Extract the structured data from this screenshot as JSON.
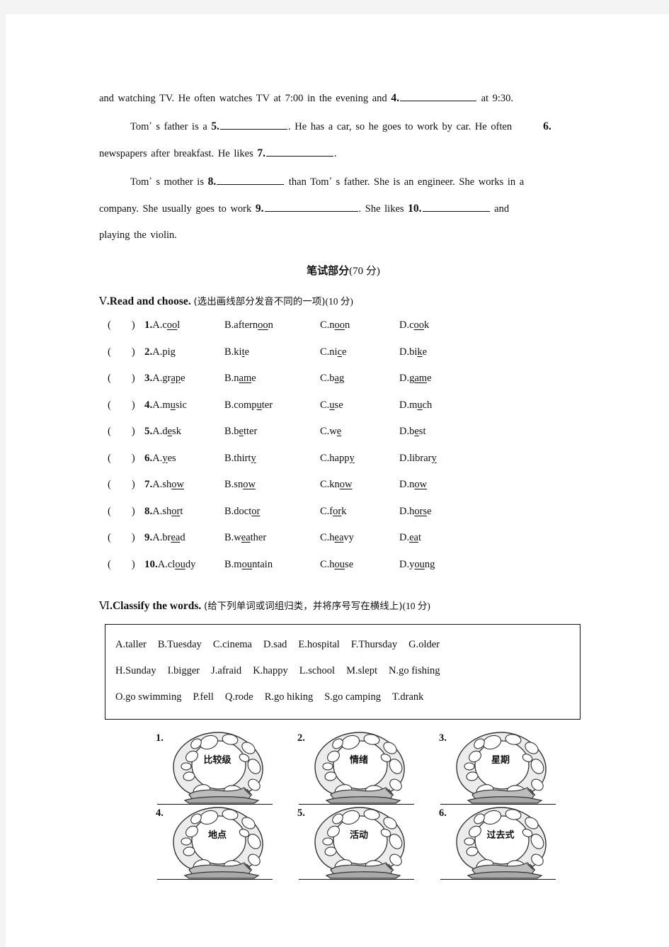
{
  "cloze": {
    "line1_before": "and watching TV. He often watches TV at 7:00 in the evening and",
    "n4": "4.",
    "line1_after": "at 9:30.",
    "p2_a": "Tom",
    "p2_b": "s father is a",
    "n5": "5.",
    "p2_c": ". He has a car, so he goes to work by car. He often",
    "n6": "6.",
    "p2_d": "newspapers after breakfast. He likes",
    "n7": "7.",
    "p2_e": ".",
    "p3_a": "Tom",
    "p3_b": "s mother is",
    "n8": "8.",
    "p3_c": "than Tom",
    "p3_d": "s father. She is an engineer. She works in a",
    "p3_e": "company. She usually goes to work",
    "n9": "9.",
    "p3_f": ". She likes",
    "n10": "10.",
    "p3_g": "and",
    "p3_h": "playing the violin.",
    "apostrophe": "’"
  },
  "part_title": {
    "cn": "笔试部分",
    "points": "(70 分)"
  },
  "section5": {
    "numeral": "Ⅴ",
    "title": ".Read and choose.",
    "cn": "(选出画线部分发音不同的一项)",
    "points": "(10 分)",
    "paren": "(        )",
    "questions": [
      {
        "num": "1.",
        "options": [
          {
            "letter": "A.",
            "pre": "c",
            "mid": "oo",
            "post": "l"
          },
          {
            "letter": "B.",
            "pre": "aftern",
            "mid": "oo",
            "post": "n"
          },
          {
            "letter": "C.",
            "pre": "n",
            "mid": "oo",
            "post": "n"
          },
          {
            "letter": "D.",
            "pre": "c",
            "mid": "oo",
            "post": "k"
          }
        ]
      },
      {
        "num": "2.",
        "options": [
          {
            "letter": "A.",
            "pre": "pi",
            "mid": "g",
            "post": ""
          },
          {
            "letter": "B.",
            "pre": "ki",
            "mid": "t",
            "post": "e"
          },
          {
            "letter": "C.",
            "pre": "ni",
            "mid": "c",
            "post": "e"
          },
          {
            "letter": "D.",
            "pre": "bi",
            "mid": "k",
            "post": "e"
          }
        ]
      },
      {
        "num": "3.",
        "options": [
          {
            "letter": "A.",
            "pre": "gr",
            "mid": "ap",
            "post": "e"
          },
          {
            "letter": "B.",
            "pre": "n",
            "mid": "am",
            "post": "e"
          },
          {
            "letter": "C.",
            "pre": "b",
            "mid": "ag",
            "post": ""
          },
          {
            "letter": "D.",
            "pre": "g",
            "mid": "am",
            "post": "e"
          }
        ]
      },
      {
        "num": "4.",
        "options": [
          {
            "letter": "A.",
            "pre": "m",
            "mid": "u",
            "post": "sic"
          },
          {
            "letter": "B.",
            "pre": "comp",
            "mid": "u",
            "post": "ter"
          },
          {
            "letter": "C.",
            "pre": "",
            "mid": "u",
            "post": "se"
          },
          {
            "letter": "D.",
            "pre": "m",
            "mid": "u",
            "post": "ch"
          }
        ]
      },
      {
        "num": "5.",
        "options": [
          {
            "letter": "A.",
            "pre": "d",
            "mid": "e",
            "post": "sk"
          },
          {
            "letter": "B.",
            "pre": "b",
            "mid": "e",
            "post": "tter"
          },
          {
            "letter": "C.",
            "pre": "w",
            "mid": "e",
            "post": ""
          },
          {
            "letter": "D.",
            "pre": "b",
            "mid": "e",
            "post": "st"
          }
        ]
      },
      {
        "num": "6.",
        "options": [
          {
            "letter": "A.",
            "pre": "",
            "mid": "y",
            "post": "es"
          },
          {
            "letter": "B.",
            "pre": "thirt",
            "mid": "y",
            "post": ""
          },
          {
            "letter": "C.",
            "pre": "happ",
            "mid": "y",
            "post": ""
          },
          {
            "letter": "D.",
            "pre": "librar",
            "mid": "y",
            "post": ""
          }
        ]
      },
      {
        "num": "7.",
        "options": [
          {
            "letter": "A.",
            "pre": "sh",
            "mid": "ow",
            "post": ""
          },
          {
            "letter": "B.",
            "pre": "sn",
            "mid": "ow",
            "post": ""
          },
          {
            "letter": "C.",
            "pre": "kn",
            "mid": "ow",
            "post": ""
          },
          {
            "letter": "D.",
            "pre": "n",
            "mid": "ow",
            "post": ""
          }
        ]
      },
      {
        "num": "8.",
        "options": [
          {
            "letter": "A.",
            "pre": "sh",
            "mid": "or",
            "post": "t"
          },
          {
            "letter": "B.",
            "pre": "doct",
            "mid": "or",
            "post": ""
          },
          {
            "letter": "C.",
            "pre": "f",
            "mid": "or",
            "post": "k"
          },
          {
            "letter": "D.",
            "pre": "h",
            "mid": "ors",
            "post": "e"
          }
        ]
      },
      {
        "num": "9.",
        "options": [
          {
            "letter": "A.",
            "pre": "br",
            "mid": "ea",
            "post": "d"
          },
          {
            "letter": "B.",
            "pre": "w",
            "mid": "ea",
            "post": "ther"
          },
          {
            "letter": "C.",
            "pre": "h",
            "mid": "ea",
            "post": "vy"
          },
          {
            "letter": "D.",
            "pre": "",
            "mid": "ea",
            "post": "t"
          }
        ]
      },
      {
        "num": "10.",
        "options": [
          {
            "letter": "A.",
            "pre": "cl",
            "mid": "ou",
            "post": "dy"
          },
          {
            "letter": "B.",
            "pre": "m",
            "mid": "ou",
            "post": "ntain"
          },
          {
            "letter": "C.",
            "pre": "h",
            "mid": "ou",
            "post": "se"
          },
          {
            "letter": "D.",
            "pre": "y",
            "mid": "ou",
            "post": "ng"
          }
        ]
      }
    ]
  },
  "section6": {
    "numeral": "Ⅵ",
    "title": ".Classify the words.",
    "cn": "(给下列单词或词组归类，并将序号写在横线上)",
    "points": "(10 分)",
    "wordbank": [
      [
        "A.taller",
        "B.Tuesday",
        "C.cinema",
        "D.sad",
        "E.hospital",
        "F.Thursday",
        "G.older"
      ],
      [
        "H.Sunday",
        "I.bigger",
        "J.afraid",
        "K.happy",
        "L.school",
        "M.slept",
        "N.go fishing"
      ],
      [
        "O.go swimming",
        "P.fell",
        "Q.rode",
        "R.go hiking",
        "S.go camping",
        "T.drank"
      ]
    ],
    "categories": [
      {
        "index": "1.",
        "label": "比较级"
      },
      {
        "index": "2.",
        "label": "情绪"
      },
      {
        "index": "3.",
        "label": "星期"
      },
      {
        "index": "4.",
        "label": "地点"
      },
      {
        "index": "5.",
        "label": "活动"
      },
      {
        "index": "6.",
        "label": "过去式"
      }
    ]
  }
}
